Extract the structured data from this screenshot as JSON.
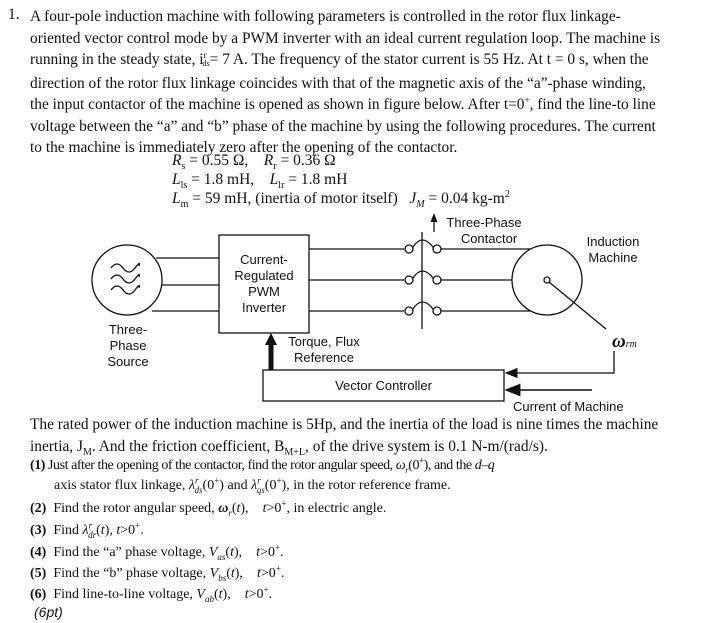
{
  "problem": {
    "number": "1.",
    "intro_lines": [
      "A four-pole induction machine with following parameters is controlled in the rotor flux linkage-",
      "oriented vector control mode by a PWM inverter with an ideal current regulation loop. The machine is",
      "running in the steady state, i",
      "direction of the rotor flux linkage coincides with that of the magnetic axis of the “a”-phase winding,",
      "the input contactor of the machine is opened as shown in figure below. After t=0",
      "voltage between the “a” and “b” phase of the machine by using the following procedures. The current",
      "to the machine is immediately zero after the opening of the contactor."
    ],
    "line3_rest": "= 7 A. The frequency of the stator current is 55 Hz. At t = 0 s, when the",
    "line5_rest": ", find the line-to line",
    "ids_sup": "r",
    "ids_sub": "ds",
    "t0_sup": "+",
    "parameters": {
      "Rs": "0.55 Ω",
      "Rr": "0.36 Ω",
      "Lls": "1.8 mH",
      "Llr": "1.8 mH",
      "Lm": "59 mH",
      "inertia_note": "(inertia of motor itself)",
      "JM": "0.04 kg-m"
    },
    "after_text_1": "The rated power of the induction machine is 5Hp, and the inertia of the load is nine times the machine",
    "after_text_2a": "inertia, J",
    "after_text_2b": ". And the friction coefficient, B",
    "after_text_2c": ", of the drive system is 0.1 N-m/(rad/s).",
    "sub_M": "M",
    "sub_ML": "M+L",
    "questions": [
      {
        "num": "(1)",
        "text": "Just after the opening of the contactor, find the rotor angular speed, ω_r(0+), and the d–q",
        "cont": "axis stator flux linkage, λ^r_ds(0+) and λ^r_qs(0+), in the rotor reference frame."
      },
      {
        "num": "(2)",
        "text": "Find the rotor angular speed, ω_r(t),   t>0+, in electric angle."
      },
      {
        "num": "(3)",
        "text": "Find λ^r_dr(t), t>0+."
      },
      {
        "num": "(4)",
        "text": "Find the “a” phase voltage, V_as(t),   t>0+."
      },
      {
        "num": "(5)",
        "text": "Find the “b” phase voltage, V_bs(t),   t>0+."
      },
      {
        "num": "(6)",
        "text": "Find line-to-line voltage, V_ab(t),   t>0+."
      }
    ],
    "q1_a": "Just after the opening of the contactor, find the rotor angular speed, ",
    "q1_b": ", and the ",
    "q1_c": "axis stator flux linkage, ",
    "q1_d": " and ",
    "q1_e": ", in the rotor reference frame.",
    "q2_a": "Find the rotor angular speed, ",
    "q2_b": ", in electric angle.",
    "q3_a": "Find ",
    "q4_a": "Find the “a” phase voltage, ",
    "q5_a": "Find the “b” phase voltage, ",
    "q6_a": "Find line-to-line voltage, ",
    "points": "(6pt)"
  },
  "diagram": {
    "source_label": [
      "Three-",
      "Phase",
      "Source"
    ],
    "inverter_label": [
      "Current-",
      "Regulated",
      "PWM",
      "Inverter"
    ],
    "contactor_label": [
      "Three-Phase",
      "Contactor"
    ],
    "machine_label": [
      "Induction",
      "Machine"
    ],
    "reference_label": [
      "Torque, Flux",
      "Reference"
    ],
    "controller_label": "Vector Controller",
    "speed_label": "ω",
    "speed_sub": "rm",
    "current_label": "Current of Machine"
  }
}
